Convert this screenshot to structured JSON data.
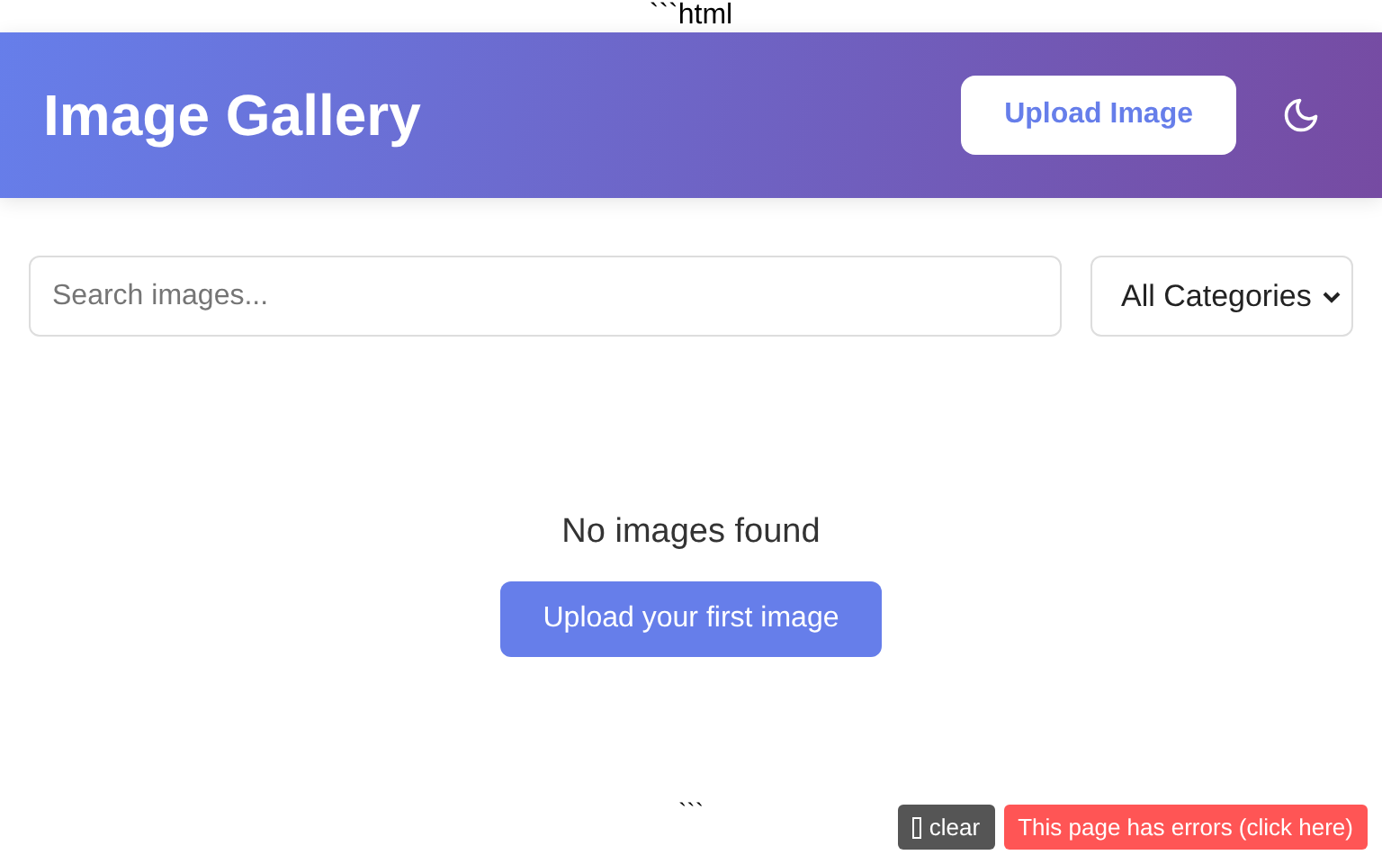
{
  "code_fence_open": "```html",
  "header": {
    "title": "Image Gallery",
    "upload_button": "Upload Image"
  },
  "search": {
    "placeholder": "Search images..."
  },
  "category_select": {
    "value": "All Categories"
  },
  "empty_state": {
    "message": "No images found",
    "button": "Upload your first image"
  },
  "code_fence_close": "```",
  "error_bar": {
    "clear_button": "clear",
    "error_button": "This page has errors (click here)"
  }
}
